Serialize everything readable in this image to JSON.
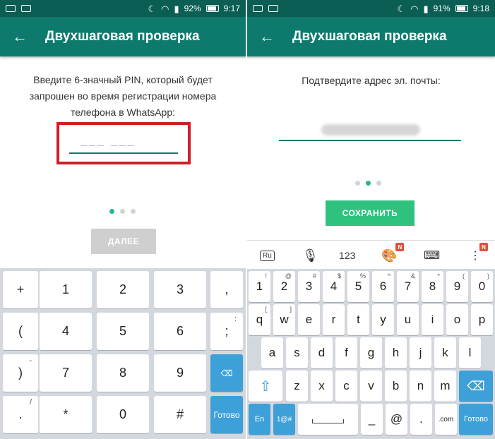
{
  "left": {
    "status": {
      "battery_percent": "92%",
      "time": "9:17"
    },
    "app_title": "Двухшаговая проверка",
    "instruction_lines": [
      "Введите 6-значный PIN, который будет",
      "запрошен во время регистрации номера",
      "телефона в WhatsApp:"
    ],
    "pin_placeholder": "___ ___",
    "page_indicator": {
      "total": 3,
      "active": 1
    },
    "next_button": "ДАЛЕЕ",
    "keypad": [
      {
        "label": "+",
        "hint": ""
      },
      {
        "label": "1",
        "hint": ""
      },
      {
        "label": "2",
        "hint": ""
      },
      {
        "label": "3",
        "hint": ""
      },
      {
        "label": ",",
        "hint": ""
      },
      {
        "label": "(",
        "hint": ""
      },
      {
        "label": "4",
        "hint": ""
      },
      {
        "label": "5",
        "hint": ""
      },
      {
        "label": "6",
        "hint": ""
      },
      {
        "label": ";",
        "hint": ":"
      },
      {
        "label": ")",
        "hint": "-"
      },
      {
        "label": "7",
        "hint": ""
      },
      {
        "label": "8",
        "hint": ""
      },
      {
        "label": "9",
        "hint": ""
      },
      {
        "label": "⌫",
        "hint": ""
      },
      {
        "label": ".",
        "hint": "/"
      },
      {
        "label": "*",
        "hint": ""
      },
      {
        "label": "0",
        "hint": ""
      },
      {
        "label": "#",
        "hint": ""
      },
      {
        "label": "Готово",
        "hint": ""
      }
    ]
  },
  "right": {
    "status": {
      "battery_percent": "91%",
      "time": "9:18"
    },
    "app_title": "Двухшаговая проверка",
    "instruction": "Подтвердите адрес эл. почты:",
    "page_indicator": {
      "total": 3,
      "active": 2
    },
    "save_button": "СОХРАНИТЬ",
    "suggestion_bar": {
      "lang": "Ru",
      "numbers": "123",
      "badge": "N"
    },
    "rows": [
      [
        {
          "k": "1",
          "h": "!"
        },
        {
          "k": "2",
          "h": "@"
        },
        {
          "k": "3",
          "h": "#"
        },
        {
          "k": "4",
          "h": "$"
        },
        {
          "k": "5",
          "h": "%"
        },
        {
          "k": "6",
          "h": "^"
        },
        {
          "k": "7",
          "h": "&"
        },
        {
          "k": "8",
          "h": "*"
        },
        {
          "k": "9",
          "h": "("
        },
        {
          "k": "0",
          "h": ")"
        }
      ],
      [
        {
          "k": "q",
          "h": "["
        },
        {
          "k": "w",
          "h": "]"
        },
        {
          "k": "e",
          "h": ""
        },
        {
          "k": "r",
          "h": ""
        },
        {
          "k": "t",
          "h": ""
        },
        {
          "k": "y",
          "h": ""
        },
        {
          "k": "u",
          "h": ""
        },
        {
          "k": "i",
          "h": ""
        },
        {
          "k": "o",
          "h": ""
        },
        {
          "k": "p",
          "h": ""
        }
      ],
      [
        {
          "k": "a",
          "h": ""
        },
        {
          "k": "s",
          "h": ""
        },
        {
          "k": "d",
          "h": ""
        },
        {
          "k": "f",
          "h": ""
        },
        {
          "k": "g",
          "h": ""
        },
        {
          "k": "h",
          "h": ""
        },
        {
          "k": "j",
          "h": ""
        },
        {
          "k": "k",
          "h": ""
        },
        {
          "k": "l",
          "h": ""
        }
      ],
      [
        {
          "k": "z",
          "h": ""
        },
        {
          "k": "x",
          "h": ""
        },
        {
          "k": "c",
          "h": ""
        },
        {
          "k": "v",
          "h": ""
        },
        {
          "k": "b",
          "h": ""
        },
        {
          "k": "n",
          "h": ""
        },
        {
          "k": "m",
          "h": ""
        }
      ]
    ],
    "bottom_row": {
      "lang": "En",
      "symbols": "1@#",
      "at": "@",
      "dash": "_",
      "dot": ".",
      "com": ".com",
      "done": "Готово"
    }
  }
}
